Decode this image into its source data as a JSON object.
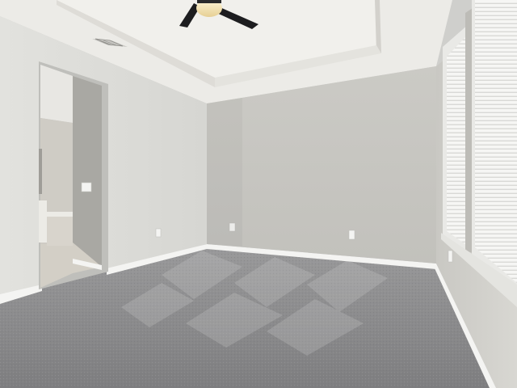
{
  "scene": {
    "kind": "empty-bedroom-interior",
    "palette": {
      "wall_left": "#dcdcd8",
      "wall_back": "#c7c6c1",
      "wall_right": "#d1d0cb",
      "ceiling": "#ecebe7",
      "carpet": "#8f8f91",
      "baseboard": "#f4f4f2",
      "fan_blade": "#1d1d1f",
      "window_light": "#f7f7f5"
    },
    "objects": [
      "ceiling-fan",
      "tray-ceiling",
      "air-vent",
      "doorway-to-bathroom",
      "bathtub",
      "light-switch",
      "wall-outlets",
      "window-blinds",
      "carpet-floor",
      "baseboards"
    ]
  }
}
